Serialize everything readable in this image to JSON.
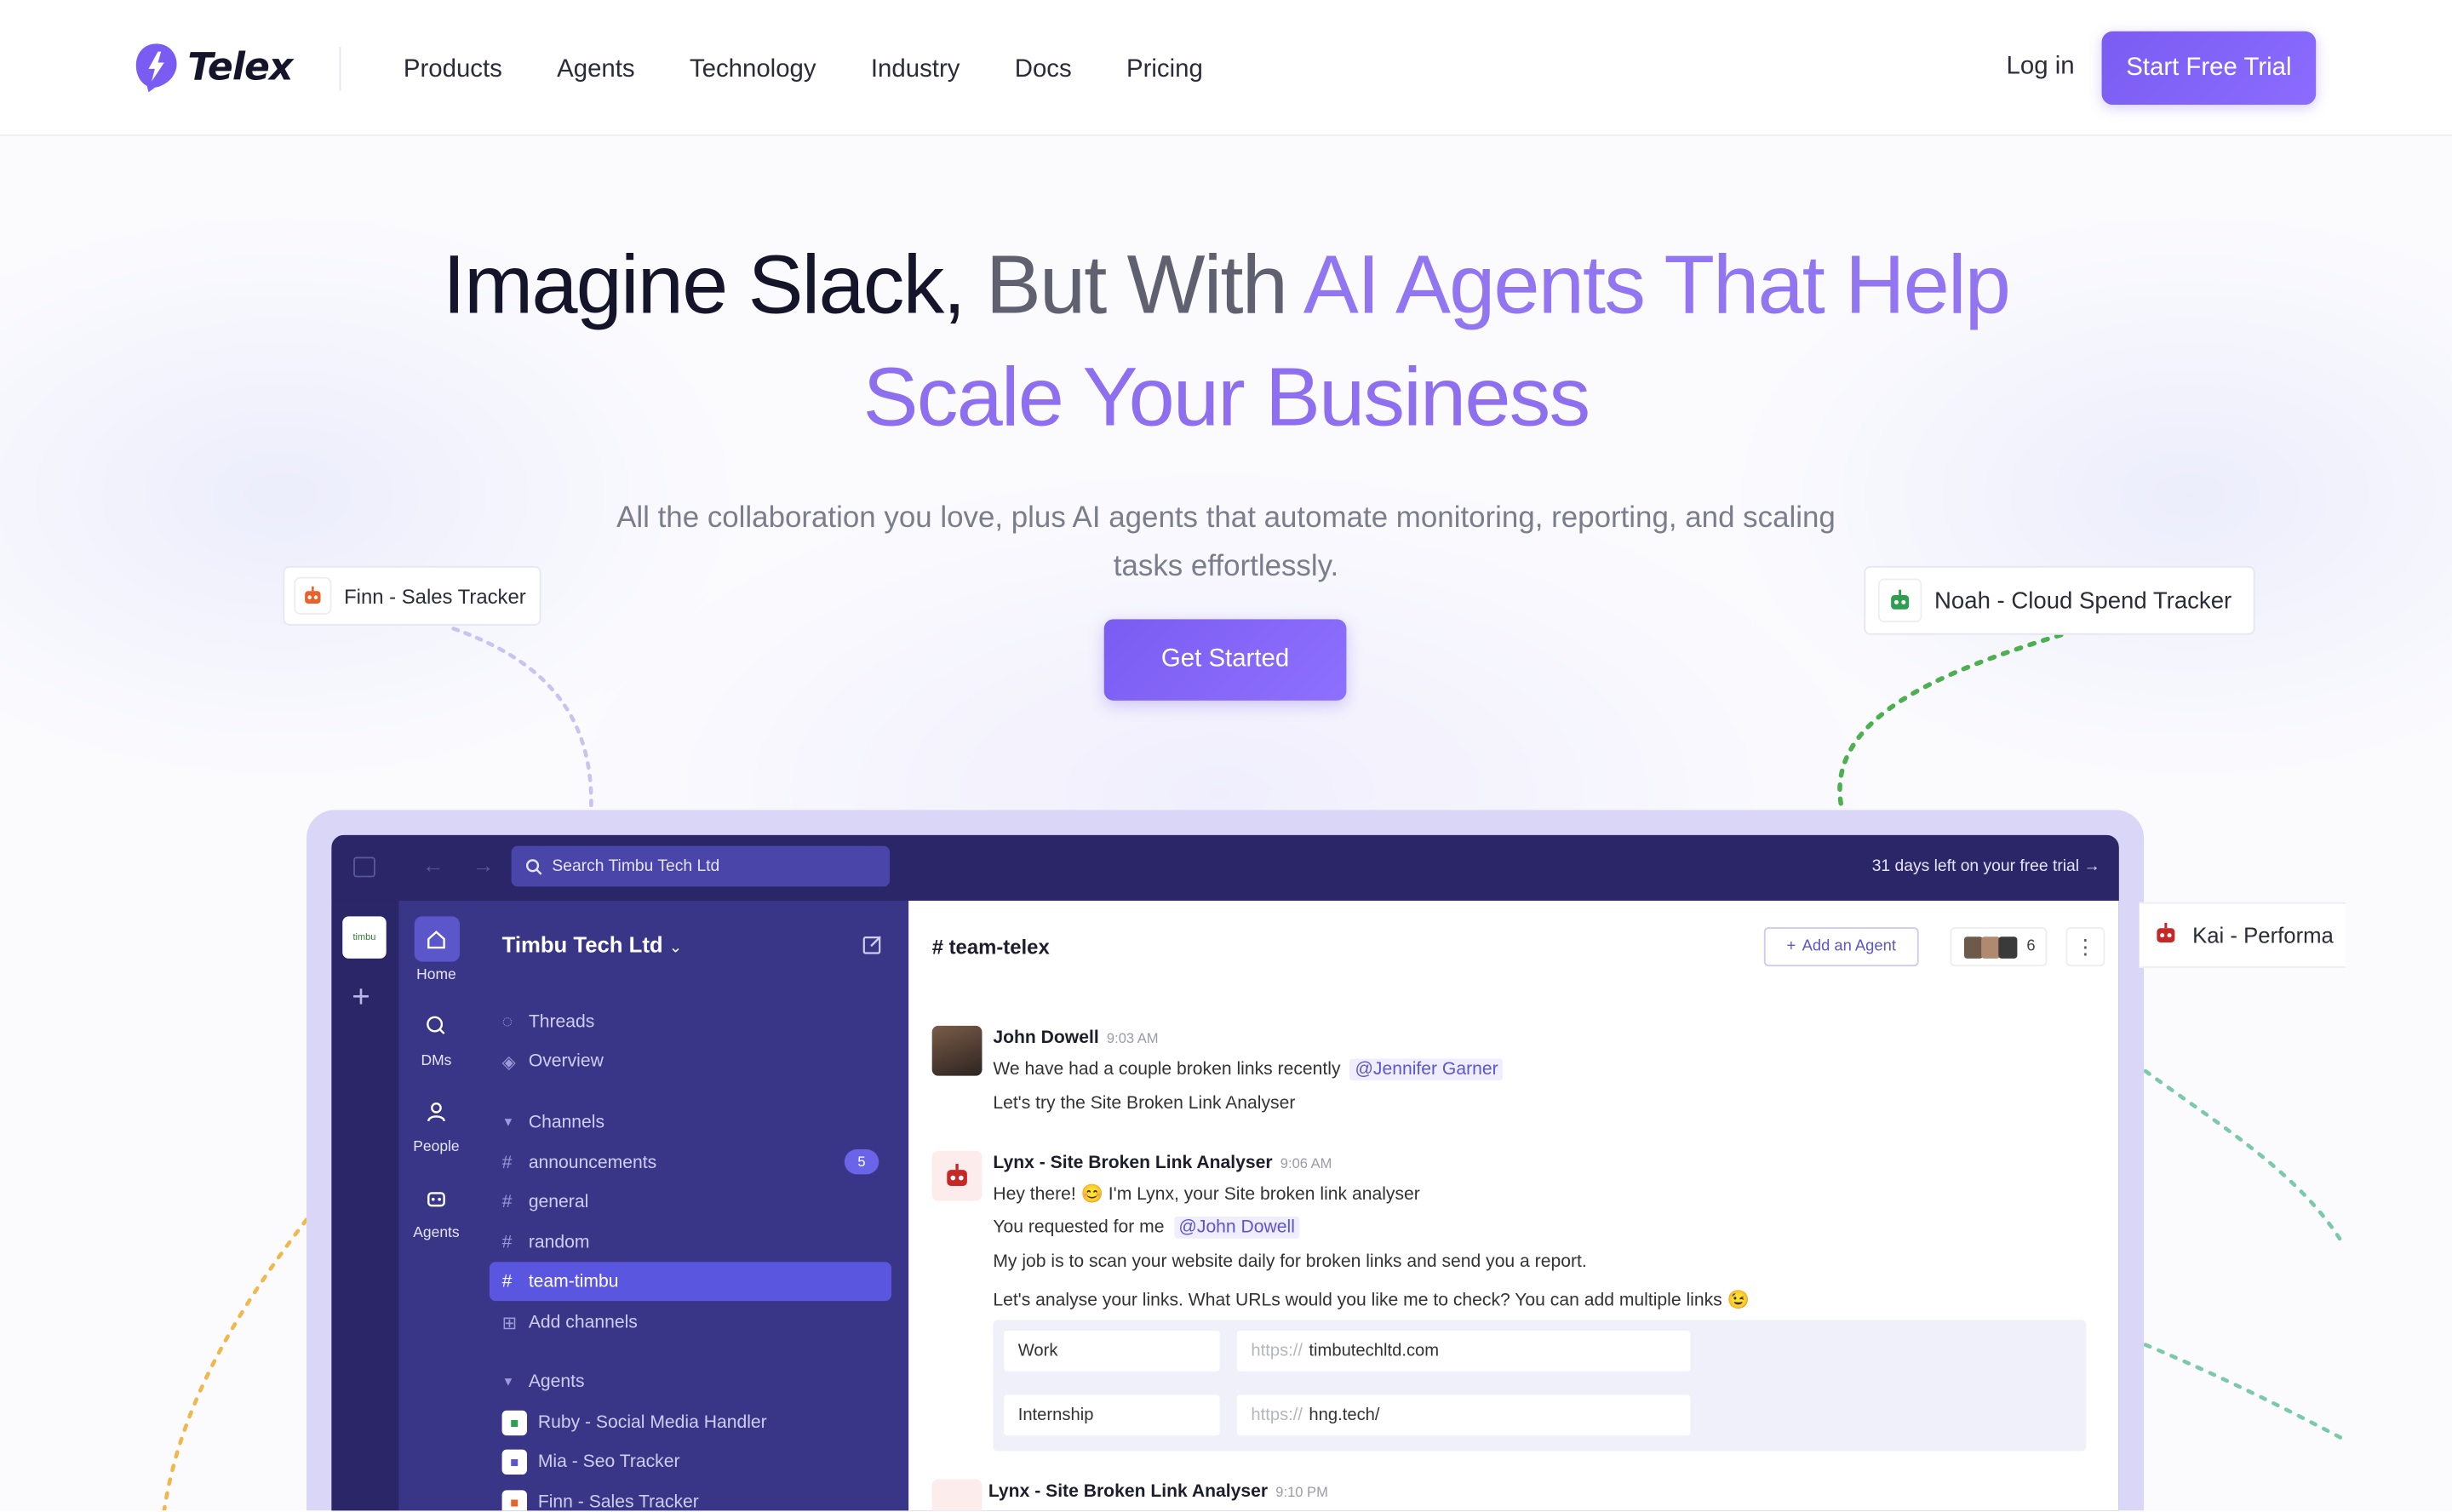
{
  "brand": {
    "name": "Telex",
    "accent": "#7b5cf2"
  },
  "nav": {
    "items": [
      "Products",
      "Agents",
      "Technology",
      "Industry",
      "Docs",
      "Pricing"
    ],
    "login": "Log in",
    "trial": "Start Free Trial"
  },
  "hero": {
    "line1_dark": "Imagine Slack,",
    "line1_grey": " But With ",
    "line1_purple": "AI Agents That Help",
    "line2": "Scale Your Business",
    "subtitle": "All the collaboration you love, plus AI agents that automate monitoring, reporting, and scaling tasks effortlessly.",
    "cta": "Get Started"
  },
  "floating_agents": {
    "finn": "Finn - Sales Tracker",
    "noah": "Noah - Cloud Spend Tracker",
    "kai": "Kai - Performa"
  },
  "app": {
    "search_placeholder": "Search Timbu Tech Ltd",
    "trial_notice": "31 days left on your free trial",
    "ws_logo": "timbu",
    "rail": {
      "home": "Home",
      "dms": "DMs",
      "people": "People",
      "agents": "Agents"
    },
    "workspace": "Timbu Tech Ltd",
    "sidebar": {
      "threads": "Threads",
      "overview": "Overview",
      "channels_header": "Channels",
      "channels": [
        "announcements",
        "general",
        "random",
        "team-timbu"
      ],
      "announcements_badge": "5",
      "add_channels": "Add channels",
      "agents_header": "Agents",
      "agents": [
        "Ruby - Social Media Handler",
        "Mia - Seo Tracker",
        "Finn - Sales Tracker"
      ]
    },
    "channel": {
      "title": "# team-telex",
      "add_agent": "Add an Agent",
      "member_count": "6"
    },
    "messages": {
      "m1": {
        "author": "John Dowell",
        "time": "9:03 AM",
        "line1": "We have had a couple broken links recently",
        "mention": "@Jennifer Garner",
        "line2": "Let's try the Site Broken Link Analyser"
      },
      "m2": {
        "author": "Lynx - Site Broken Link Analyser",
        "time": "9:06 AM",
        "line1": "Hey there! 😊 I'm Lynx, your Site broken link analyser",
        "line2": "You requested for me",
        "mention": "@John Dowell",
        "line3": "My job is to scan your website daily for broken links and send you a report.",
        "line4": "Let's analyse your links. What URLs would you like me to check? You can add multiple links 😉"
      },
      "form": [
        {
          "label": "Work",
          "prefix": "https://",
          "url": "timbutechltd.com"
        },
        {
          "label": "Internship",
          "prefix": "https://",
          "url": "hng.tech/"
        }
      ],
      "m3": {
        "author": "Lynx - Site Broken Link Analyser",
        "time": "9:10 PM"
      }
    }
  }
}
